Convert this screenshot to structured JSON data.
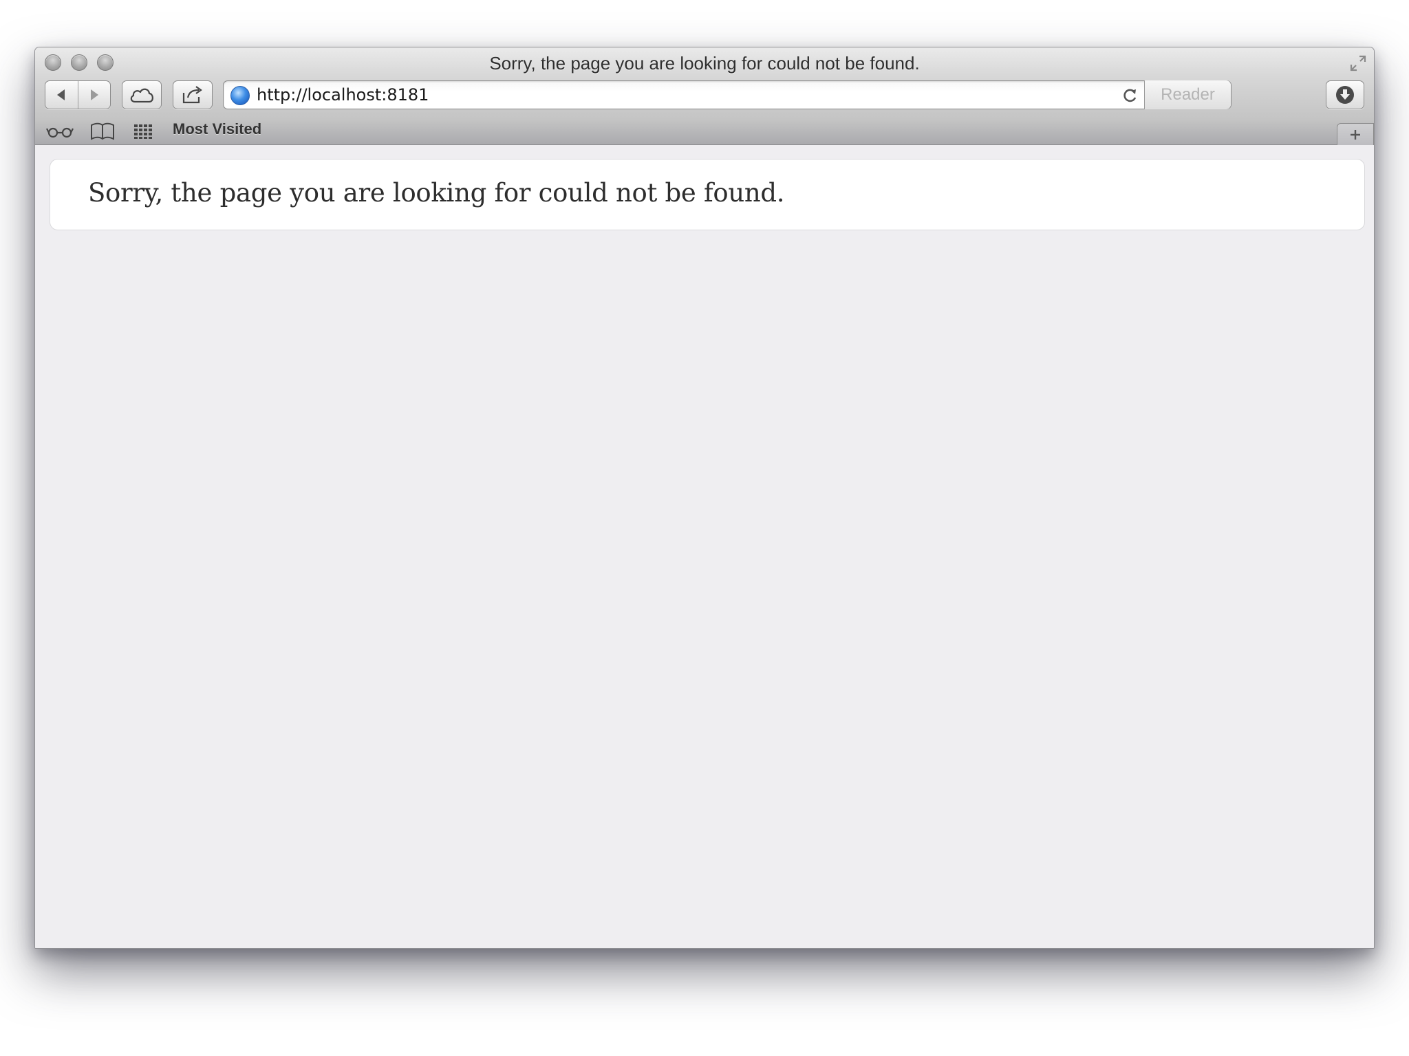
{
  "window": {
    "title": "Sorry, the page you are looking for could not be found."
  },
  "toolbar": {
    "address": {
      "value": "http://localhost:8181",
      "placeholder": ""
    },
    "reader_label": "Reader"
  },
  "bookmarks": {
    "most_visited_label": "Most Visited"
  },
  "page": {
    "error_message": "Sorry, the page you are looking for could not be found."
  },
  "icons": {
    "back": "back-arrow-icon",
    "forward": "forward-arrow-icon",
    "icloud": "cloud-icon",
    "share": "share-icon",
    "site": "globe-icon",
    "reload": "reload-icon",
    "downloads": "download-icon",
    "reading_list": "glasses-icon",
    "bookmarks": "book-icon",
    "top_sites": "grid-icon",
    "new_tab": "plus-icon",
    "fullscreen": "fullscreen-icon"
  },
  "colors": {
    "page_background": "#efeef1",
    "error_box": "#ffffff",
    "text": "#2d2d2d"
  }
}
